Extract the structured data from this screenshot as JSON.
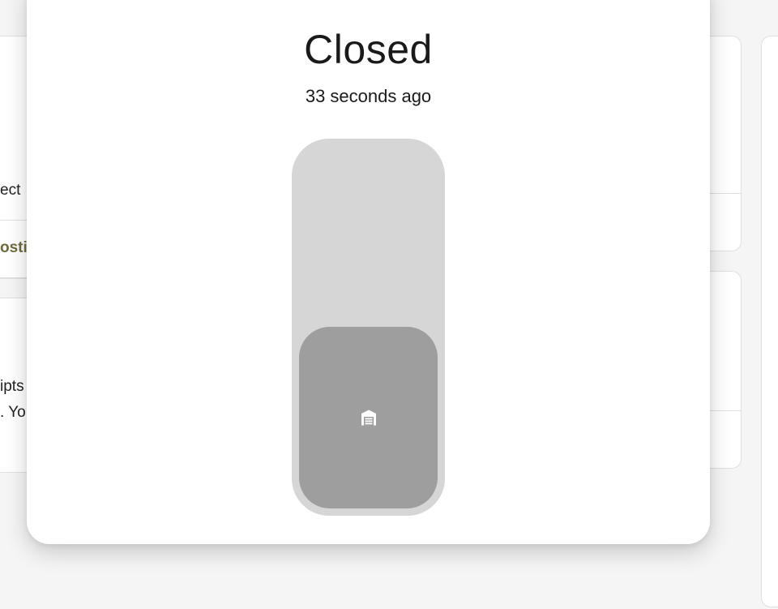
{
  "dialog": {
    "state": "Closed",
    "last_changed": "33 seconds ago",
    "cover_position_percent": 0,
    "cover_icon": "garage-icon"
  },
  "background": {
    "left_card_text_1": "ect",
    "left_card_link": "osti",
    "left_card_text_2": "ipts",
    "left_card_text_3": ". Yo"
  },
  "colors": {
    "track": "#d6d6d6",
    "thumb": "#9e9e9e",
    "link_olive": "#6e6b3e"
  }
}
